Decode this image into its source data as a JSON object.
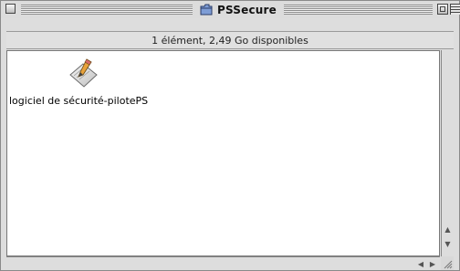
{
  "window": {
    "title": "PSSecure",
    "info": "1 élément, 2,49 Go disponibles"
  },
  "items": [
    {
      "label": "logiciel de sécurité-pilotePS",
      "icon": "installer-document-icon"
    }
  ],
  "colors": {
    "window_bg": "#dddddd",
    "content_bg": "#ffffff",
    "folder_blue": "#6f8fc8"
  },
  "icons": {
    "close": "close-box-icon",
    "zoom": "zoom-box-icon",
    "collapse": "collapse-box-icon",
    "folder": "folder-icon",
    "scroll_up": "scroll-up-arrow-icon",
    "scroll_down": "scroll-down-arrow-icon",
    "scroll_left": "scroll-left-arrow-icon",
    "scroll_right": "scroll-right-arrow-icon",
    "grow": "resize-grip-icon"
  },
  "glyphs": {
    "up": "▲",
    "down": "▼",
    "left": "◀",
    "right": "▶"
  }
}
